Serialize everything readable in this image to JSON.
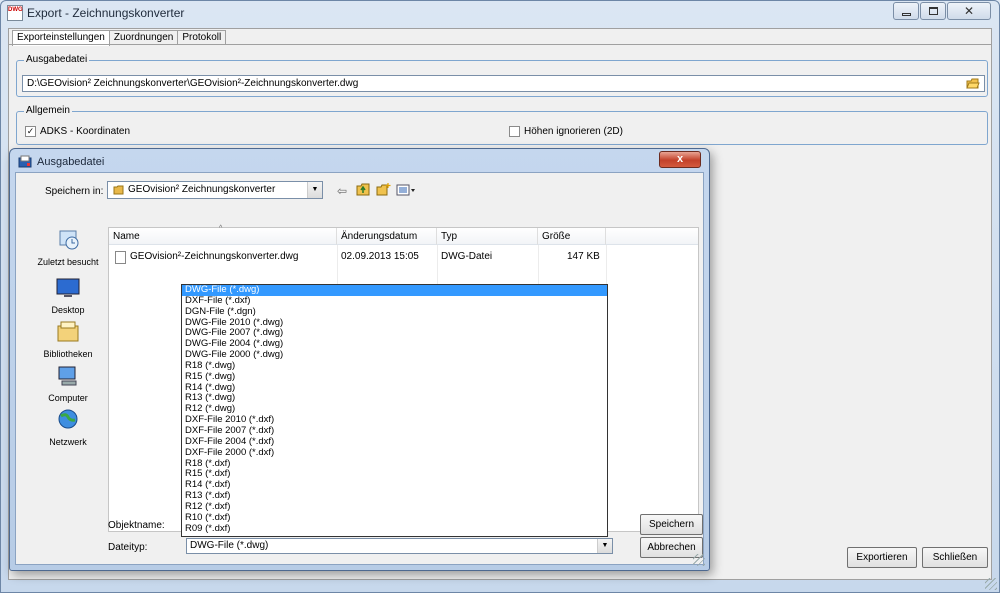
{
  "window": {
    "title": "Export - Zeichnungskonverter",
    "icon_text_top": "DWG",
    "controls": [
      "minimize",
      "maximize",
      "close"
    ]
  },
  "tabs": [
    "Exporteinstellungen",
    "Zuordnungen",
    "Protokoll"
  ],
  "ausgabedatei": {
    "label": "Ausgabedatei",
    "path": "D:\\GEOvision² Zeichnungskonverter\\GEOvision²-Zeichnungskonverter.dwg"
  },
  "allgemein": {
    "label": "Allgemein",
    "adks": {
      "label": "ADKS - Koordinaten",
      "checked": true
    },
    "hoehen": {
      "label": "Höhen ignorieren (2D)",
      "checked": false
    }
  },
  "buttons": {
    "exportieren": "Exportieren",
    "schliessen": "Schließen"
  },
  "dialog": {
    "title": "Ausgabedatei",
    "close_glyph": "x",
    "speichern_in_label": "Speichern in:",
    "folder": "GEOvision² Zeichnungskonverter",
    "places": [
      "Zuletzt besucht",
      "Desktop",
      "Bibliotheken",
      "Computer",
      "Netzwerk"
    ],
    "columns": [
      "Name",
      "Änderungsdatum",
      "Typ",
      "Größe"
    ],
    "files": [
      {
        "name": "GEOvision²-Zeichnungskonverter.dwg",
        "date": "02.09.2013 15:05",
        "type": "DWG-Datei",
        "size": "147 KB"
      }
    ],
    "objektname_label": "Objektname:",
    "dateityp_label": "Dateityp:",
    "dateityp_value": "DWG-File (*.dwg)",
    "speichern_button": "Speichern",
    "abbrechen_button": "Abbrechen",
    "filetypes": [
      "DWG-File (*.dwg)",
      "DXF-File (*.dxf)",
      "DGN-File (*.dgn)",
      "DWG-File 2010 (*.dwg)",
      "DWG-File 2007 (*.dwg)",
      "DWG-File 2004 (*.dwg)",
      "DWG-File 2000 (*.dwg)",
      "R18 (*.dwg)",
      "R15 (*.dwg)",
      "R14 (*.dwg)",
      "R13 (*.dwg)",
      "R12 (*.dwg)",
      "DXF-File 2010 (*.dxf)",
      "DXF-File 2007 (*.dxf)",
      "DXF-File 2004 (*.dxf)",
      "DXF-File 2000 (*.dxf)",
      "R18 (*.dxf)",
      "R15 (*.dxf)",
      "R14 (*.dxf)",
      "R13 (*.dxf)",
      "R12 (*.dxf)",
      "R10 (*.dxf)",
      "R09 (*.dxf)"
    ],
    "selected_filetype_index": 0
  },
  "colors": {
    "selection": "#3399ff",
    "group_border": "#7fa6cf",
    "close_red": "#c3412a"
  }
}
